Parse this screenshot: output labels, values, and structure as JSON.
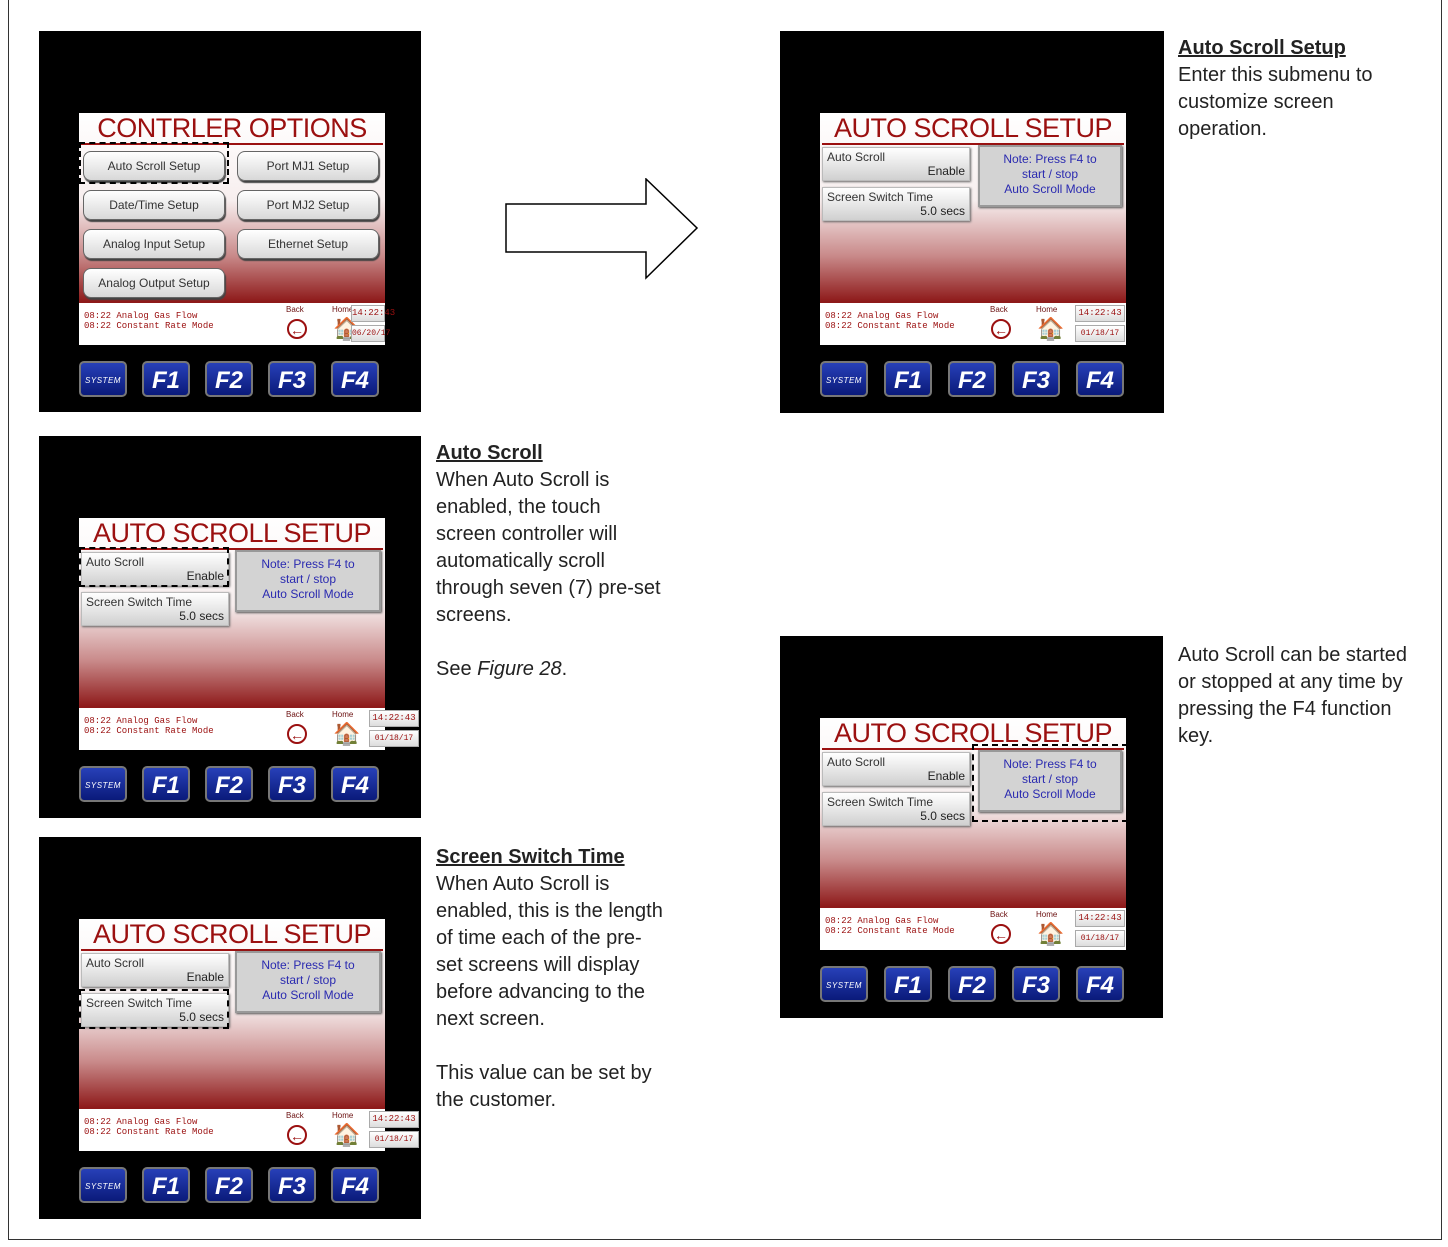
{
  "status": {
    "msg1": "08:22 Analog Gas Flow",
    "msg2": "08:22 Constant Rate Mode",
    "back_label": "Back",
    "home_label": "Home",
    "time": "14:22:43",
    "date_options": "06/20/17",
    "date_setup": "01/18/17"
  },
  "fkeys": {
    "system": "SYSTEM",
    "f1": "F1",
    "f2": "F2",
    "f3": "F3",
    "f4": "F4"
  },
  "options_screen": {
    "title": "CONTRLER OPTIONS",
    "buttons": {
      "auto_scroll": "Auto Scroll Setup",
      "port_mj1": "Port MJ1 Setup",
      "date_time": "Date/Time Setup",
      "port_mj2": "Port MJ2 Setup",
      "analog_input": "Analog Input Setup",
      "ethernet": "Ethernet Setup",
      "analog_output": "Analog Output Setup"
    }
  },
  "setup_screen": {
    "title": "AUTO SCROLL SETUP",
    "auto_scroll_label": "Auto Scroll",
    "auto_scroll_value": "Enable",
    "switch_label": "Screen Switch Time",
    "switch_value": "5.0 secs",
    "note_line1": "Note: Press F4 to",
    "note_line2": "start / stop",
    "note_line3": "Auto Scroll Mode"
  },
  "descriptions": {
    "setup_heading": "Auto Scroll Setup",
    "setup_body": "Enter this submenu to customize screen operation.",
    "auto_heading": "Auto Scroll",
    "auto_body": "When Auto Scroll is enabled, the touch screen controller will automatically scroll through seven (7) pre-set screens.",
    "auto_see_prefix": "See ",
    "auto_see_figure": "Figure 28",
    "auto_see_suffix": ".",
    "switch_heading": "Screen Switch Time",
    "switch_body": "When Auto Scroll is enabled, this is the length of time each of the pre-set screens will display before advancing to the next screen.",
    "switch_note": "This value can be set by the customer.",
    "f4_body": "Auto Scroll can be started or stopped at any time by pressing the F4 function key."
  }
}
